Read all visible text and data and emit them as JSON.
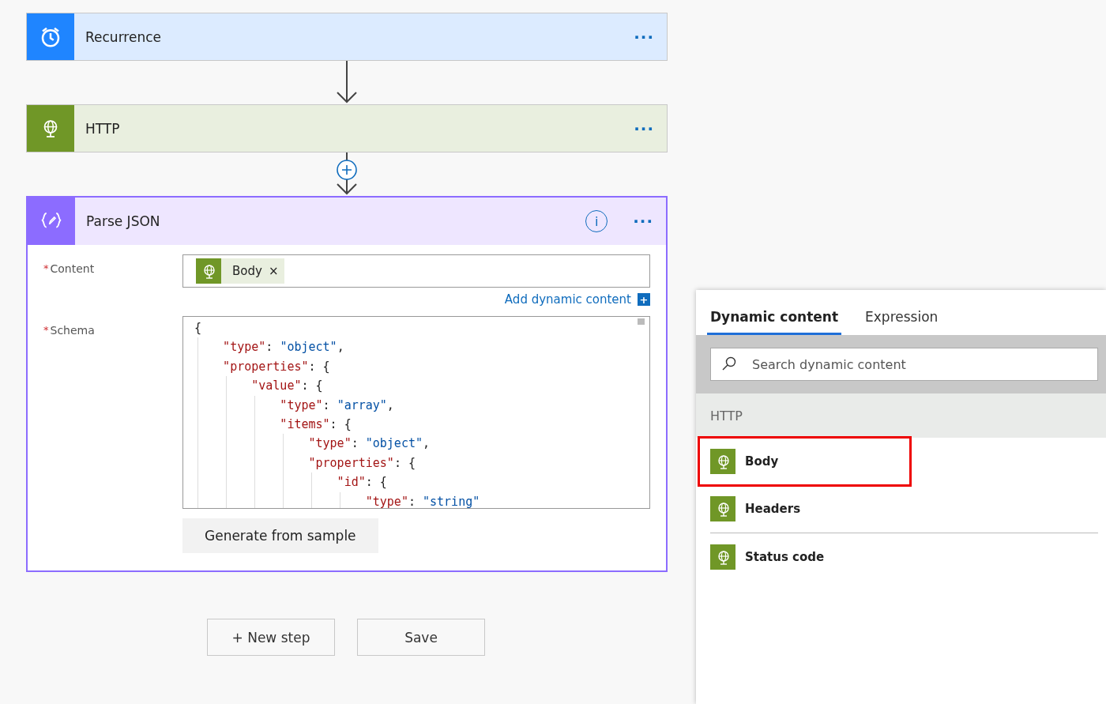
{
  "steps": [
    {
      "kind": "recurrence",
      "title": "Recurrence",
      "menu": "···"
    },
    {
      "kind": "http",
      "title": "HTTP",
      "menu": "···"
    }
  ],
  "parse_json": {
    "title": "Parse JSON",
    "info": "i",
    "menu": "···",
    "content": {
      "label": "Content",
      "required_mark": "*",
      "token": "Body",
      "remove": "×"
    },
    "add_dynamic": "Add dynamic content",
    "add_icon": "+",
    "schema": {
      "label": "Schema",
      "required_mark": "*",
      "lines": [
        [
          {
            "kind": "punct",
            "text": "{"
          }
        ],
        [
          {
            "kind": "key",
            "text": "    \"type\""
          },
          {
            "kind": "punct",
            "text": ": "
          },
          {
            "kind": "str",
            "text": "\"object\""
          },
          {
            "kind": "punct",
            "text": ","
          }
        ],
        [
          {
            "kind": "key",
            "text": "    \"properties\""
          },
          {
            "kind": "punct",
            "text": ": {"
          }
        ],
        [
          {
            "kind": "key",
            "text": "        \"value\""
          },
          {
            "kind": "punct",
            "text": ": {"
          }
        ],
        [
          {
            "kind": "key",
            "text": "            \"type\""
          },
          {
            "kind": "punct",
            "text": ": "
          },
          {
            "kind": "str",
            "text": "\"array\""
          },
          {
            "kind": "punct",
            "text": ","
          }
        ],
        [
          {
            "kind": "key",
            "text": "            \"items\""
          },
          {
            "kind": "punct",
            "text": ": {"
          }
        ],
        [
          {
            "kind": "key",
            "text": "                \"type\""
          },
          {
            "kind": "punct",
            "text": ": "
          },
          {
            "kind": "str",
            "text": "\"object\""
          },
          {
            "kind": "punct",
            "text": ","
          }
        ],
        [
          {
            "kind": "key",
            "text": "                \"properties\""
          },
          {
            "kind": "punct",
            "text": ": {"
          }
        ],
        [
          {
            "kind": "key",
            "text": "                    \"id\""
          },
          {
            "kind": "punct",
            "text": ": {"
          }
        ],
        [
          {
            "kind": "key",
            "text": "                        \"type\""
          },
          {
            "kind": "punct",
            "text": ": "
          },
          {
            "kind": "str",
            "text": "\"string\""
          }
        ]
      ]
    },
    "generate": "Generate from sample"
  },
  "actions": {
    "new_step": "+ New step",
    "save": "Save"
  },
  "panel": {
    "tabs": [
      {
        "label": "Dynamic content",
        "selected": true
      },
      {
        "label": "Expression",
        "selected": false
      }
    ],
    "search": {
      "placeholder": "Search dynamic content"
    },
    "group": "HTTP",
    "items": [
      {
        "label": "Body",
        "highlighted": true
      },
      {
        "label": "Headers",
        "highlighted": false
      },
      {
        "label": "Status code",
        "highlighted": false
      }
    ]
  }
}
